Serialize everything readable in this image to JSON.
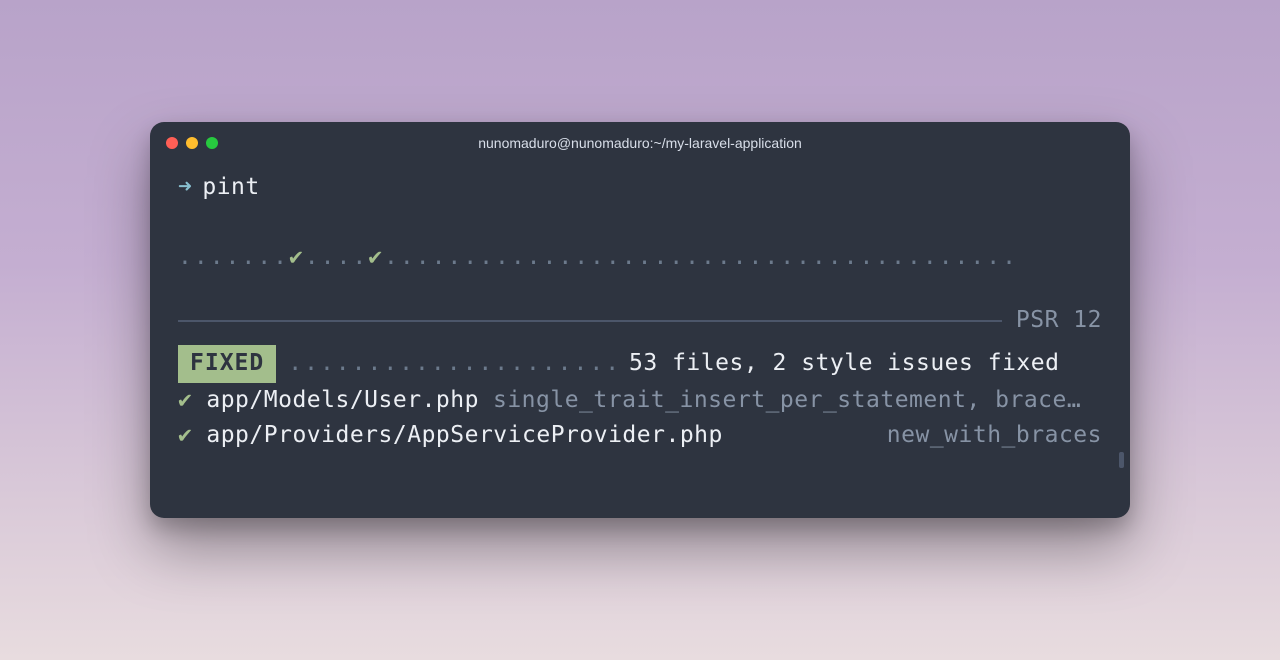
{
  "window": {
    "title": "nunomaduro@nunomaduro:~/my-laravel-application"
  },
  "prompt": {
    "symbol": "➜",
    "command": "pint"
  },
  "progress": {
    "dots_before_1": ".......",
    "check": "✔",
    "dots_between": "....",
    "dots_after": "........................................"
  },
  "preset": "PSR 12",
  "summary": {
    "badge": "FIXED",
    "dots": ".....................",
    "text": "53 files, 2 style issues fixed"
  },
  "files": [
    {
      "check": "✔",
      "path": "app/Models/User.php",
      "fixers": "single_trait_insert_per_statement, brace…"
    },
    {
      "check": "✔",
      "path": "app/Providers/AppServiceProvider.php",
      "fixers": "new_with_braces"
    }
  ]
}
